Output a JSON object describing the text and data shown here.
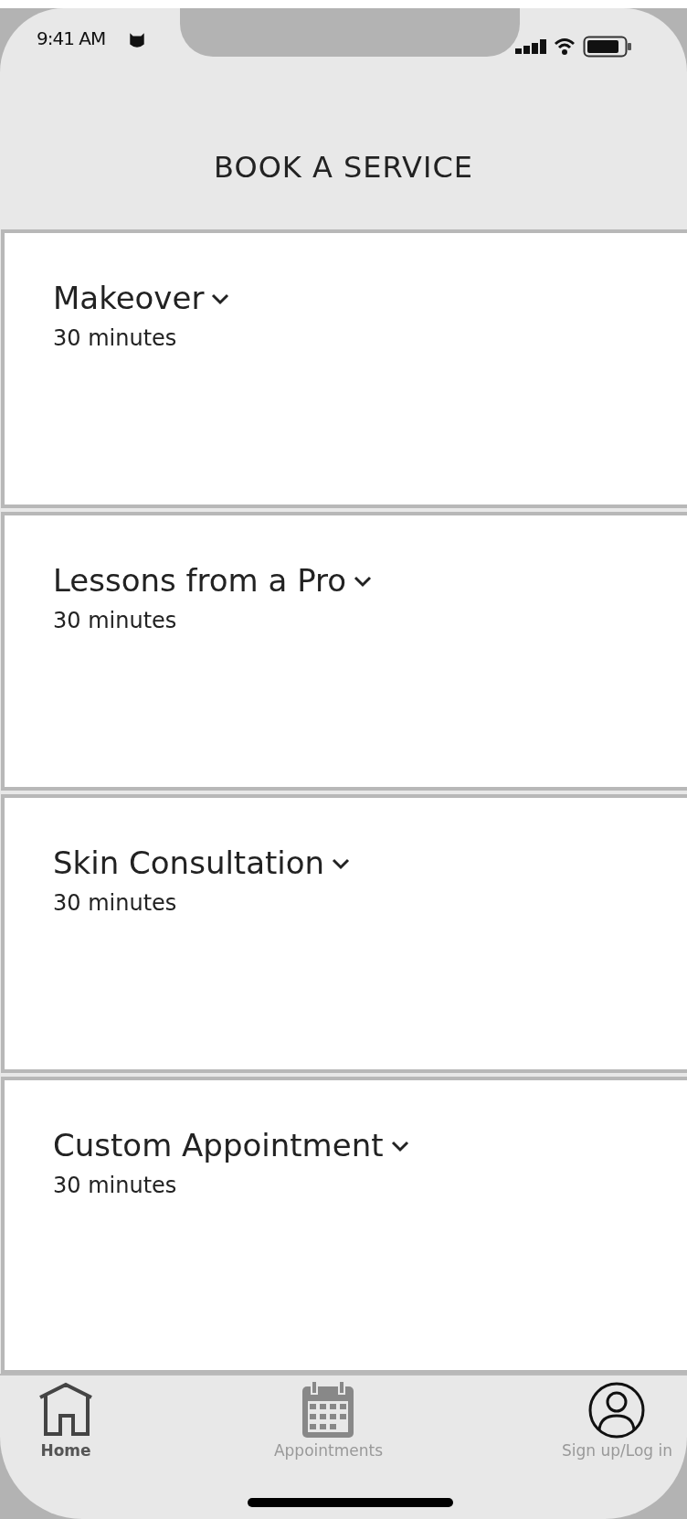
{
  "status_bar": {
    "time": "9:41 AM"
  },
  "header": {
    "title": "BOOK A SERVICE"
  },
  "services": [
    {
      "name": "Makeover",
      "duration": "30 minutes",
      "expanded": false
    },
    {
      "name": "Lessons from a Pro",
      "duration": "30 minutes",
      "expanded": false
    },
    {
      "name": "Skin Consultation",
      "duration": "30 minutes",
      "expanded": false
    },
    {
      "name": "Custom Appointment",
      "duration": "30 minutes",
      "expanded": false
    }
  ],
  "tab_bar": [
    {
      "label": "Home",
      "kind": "home",
      "selected": true
    },
    {
      "label": "Appointments",
      "kind": "calendar",
      "selected": false
    },
    {
      "label": "Sign up/Log in",
      "kind": "user",
      "selected": false
    }
  ]
}
